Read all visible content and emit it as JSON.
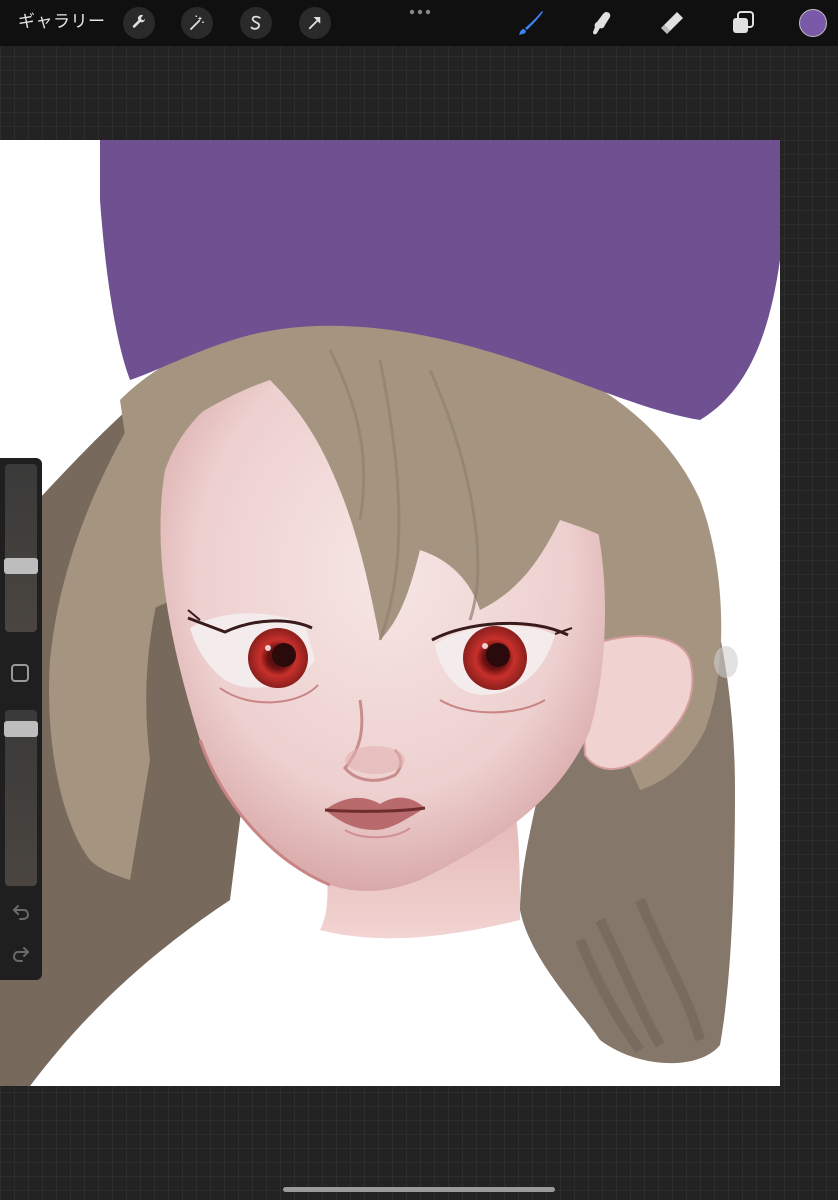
{
  "topbar": {
    "gallery_label": "ギャラリー",
    "left_tools": [
      {
        "name": "wrench-icon",
        "tool": "actions"
      },
      {
        "name": "magic-wand-icon",
        "tool": "adjustments"
      },
      {
        "name": "selection-s-icon",
        "tool": "selection"
      },
      {
        "name": "arrow-cursor-icon",
        "tool": "transform"
      }
    ],
    "right_tools": [
      {
        "name": "brush-icon",
        "tool": "paint",
        "active": true
      },
      {
        "name": "smudge-icon",
        "tool": "smudge",
        "active": false
      },
      {
        "name": "eraser-icon",
        "tool": "erase",
        "active": false
      },
      {
        "name": "layers-icon",
        "tool": "layers",
        "active": false
      }
    ],
    "current_color": "#7a5aa8",
    "active_tool_color": "#3b82f6"
  },
  "sidebar": {
    "brush_size_level": 0.62,
    "opacity_level": 0.07,
    "undo_icon": "undo-arrow-icon",
    "redo_icon": "redo-arrow-icon"
  },
  "canvas": {
    "background": "#ffffff",
    "hat_color": "#6f5191",
    "hair_color": "#a59580",
    "hair_shadow_color": "#776a5c",
    "skin_color": "#f1dcdc",
    "skin_shadow_color": "#d7a8a8",
    "eye_color": "#c8302c"
  }
}
